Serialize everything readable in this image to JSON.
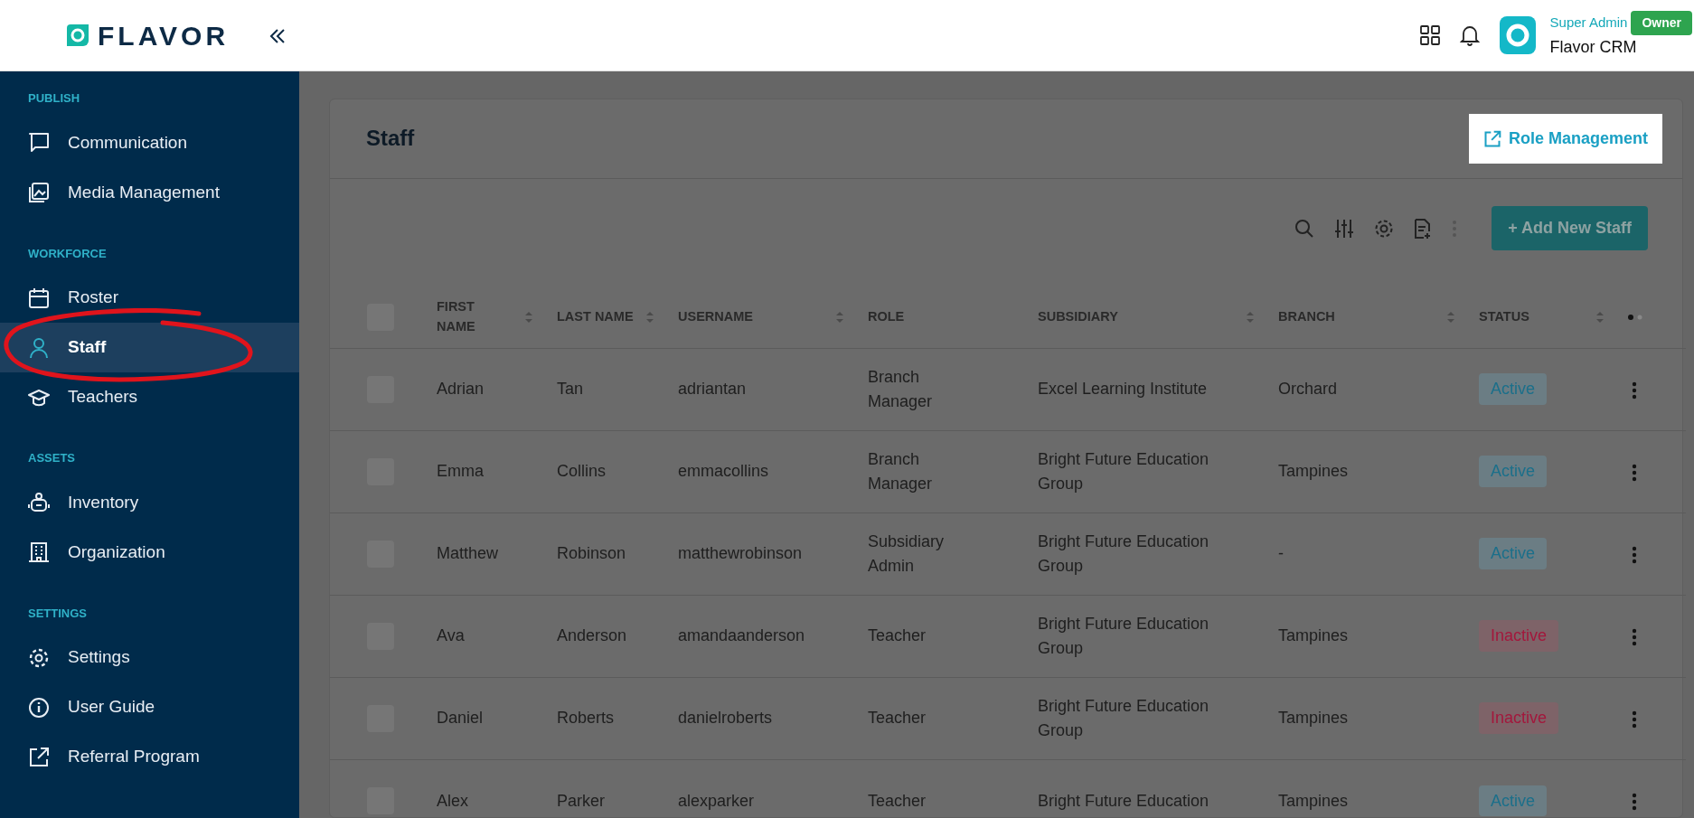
{
  "header": {
    "brand": "FLAVOR",
    "user": {
      "role": "Super Admin",
      "badge": "Owner",
      "org": "Flavor CRM"
    }
  },
  "sidebar": {
    "sections": [
      {
        "title": "PUBLISH",
        "items": [
          {
            "label": "Communication",
            "selected": false
          },
          {
            "label": "Media Management",
            "selected": false
          }
        ]
      },
      {
        "title": "WORKFORCE",
        "items": [
          {
            "label": "Roster",
            "selected": false
          },
          {
            "label": "Staff",
            "selected": true
          },
          {
            "label": "Teachers",
            "selected": false
          }
        ]
      },
      {
        "title": "ASSETS",
        "items": [
          {
            "label": "Inventory",
            "selected": false
          },
          {
            "label": "Organization",
            "selected": false
          }
        ]
      },
      {
        "title": "SETTINGS",
        "items": [
          {
            "label": "Settings",
            "selected": false
          },
          {
            "label": "User Guide",
            "selected": false
          },
          {
            "label": "Referral Program",
            "selected": false
          }
        ]
      }
    ]
  },
  "page": {
    "title": "Staff",
    "role_button": "Role Management",
    "add_button": "+ Add New Staff"
  },
  "table": {
    "select_all_checked": false,
    "columns": [
      {
        "label": "FIRST NAME",
        "sortable": true
      },
      {
        "label": "LAST NAME",
        "sortable": true
      },
      {
        "label": "USERNAME",
        "sortable": true
      },
      {
        "label": "ROLE",
        "sortable": false
      },
      {
        "label": "SUBSIDIARY",
        "sortable": true
      },
      {
        "label": "BRANCH",
        "sortable": true
      },
      {
        "label": "STATUS",
        "sortable": true
      }
    ],
    "rows": [
      {
        "checked": false,
        "cells": [
          "Adrian",
          "Tan",
          "adriantan",
          "Branch Manager",
          "Excel Learning Institute",
          "Orchard"
        ],
        "status": "Active",
        "kind": "active"
      },
      {
        "checked": false,
        "cells": [
          "Emma",
          "Collins",
          "emmacollins",
          "Branch Manager",
          "Bright Future Education Group",
          "Tampines"
        ],
        "status": "Active",
        "kind": "active"
      },
      {
        "checked": false,
        "cells": [
          "Matthew",
          "Robinson",
          "matthewrobinson",
          "Subsidiary Admin",
          "Bright Future Education Group",
          "-"
        ],
        "status": "Active",
        "kind": "active"
      },
      {
        "checked": false,
        "cells": [
          "Ava",
          "Anderson",
          "amandaanderson",
          "Teacher",
          "Bright Future Education Group",
          "Tampines"
        ],
        "status": "Inactive",
        "kind": "inactive"
      },
      {
        "checked": false,
        "cells": [
          "Daniel",
          "Roberts",
          "danielroberts",
          "Teacher",
          "Bright Future Education Group",
          "Tampines"
        ],
        "status": "Inactive",
        "kind": "inactive"
      },
      {
        "checked": false,
        "cells": [
          "Alex",
          "Parker",
          "alexparker",
          "Teacher",
          "Bright Future Education",
          "Tampines"
        ],
        "status": "Active",
        "kind": "active"
      }
    ]
  }
}
